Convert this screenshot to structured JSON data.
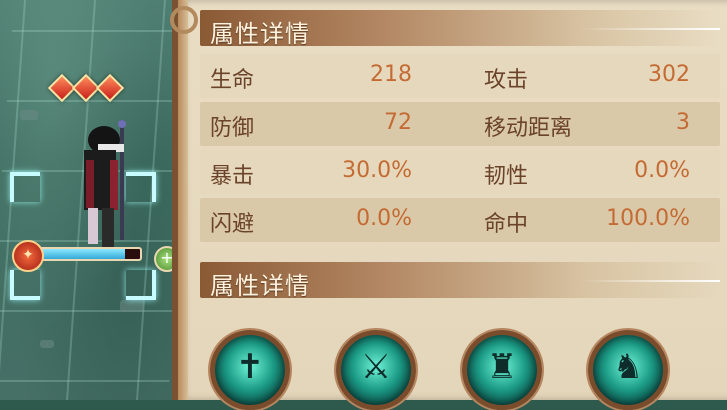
{
  "sections": {
    "stats_header": "属性详情",
    "skills_header": "属性详情"
  },
  "stats": [
    {
      "left_label": "生命",
      "left_value": "218",
      "right_label": "攻击",
      "right_value": "302"
    },
    {
      "left_label": "防御",
      "left_value": "72",
      "right_label": "移动距离",
      "right_value": "3"
    },
    {
      "left_label": "暴击",
      "left_value": "30.0%",
      "right_label": "韧性",
      "right_value": "0.0%"
    },
    {
      "left_label": "闪避",
      "left_value": "0.0%",
      "right_label": "命中",
      "right_value": "100.0%"
    }
  ],
  "unit": {
    "star_gems": 3,
    "hp_fraction": 0.88
  },
  "skills": [
    {
      "icon": "sword-cross-icon"
    },
    {
      "icon": "blade-slash-icon"
    },
    {
      "icon": "swordsman-icon"
    },
    {
      "icon": "warrior-shadow-icon"
    }
  ],
  "colors": {
    "label": "#6a432a",
    "value": "#c46b34",
    "header_text": "#fff3e0",
    "hp": "#33a8d8"
  }
}
